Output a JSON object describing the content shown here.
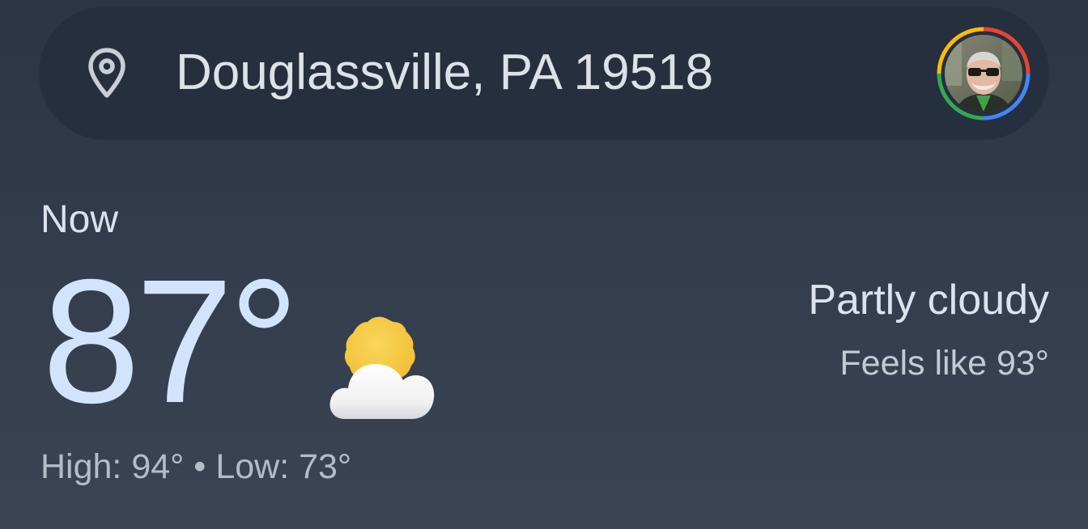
{
  "search": {
    "location": "Douglassville, PA 19518",
    "location_icon": "location-pin-icon"
  },
  "account": {
    "avatar_icon": "profile-avatar",
    "ring_colors": [
      "#ea4335",
      "#4285f4",
      "#34a853",
      "#fbbc05"
    ]
  },
  "current": {
    "label": "Now",
    "temperature": "87°",
    "condition": "Partly cloudy",
    "feels_like": "Feels like 93°",
    "high": "High: 94°",
    "separator": " • ",
    "low": "Low: 73°",
    "condition_icon": "partly-cloudy-icon"
  },
  "colors": {
    "background": "#323c4c",
    "search_bar": "#252f3d",
    "temperature": "#d4e3fc",
    "sun": "#f6c945",
    "cloud": "#f2f2f4"
  }
}
